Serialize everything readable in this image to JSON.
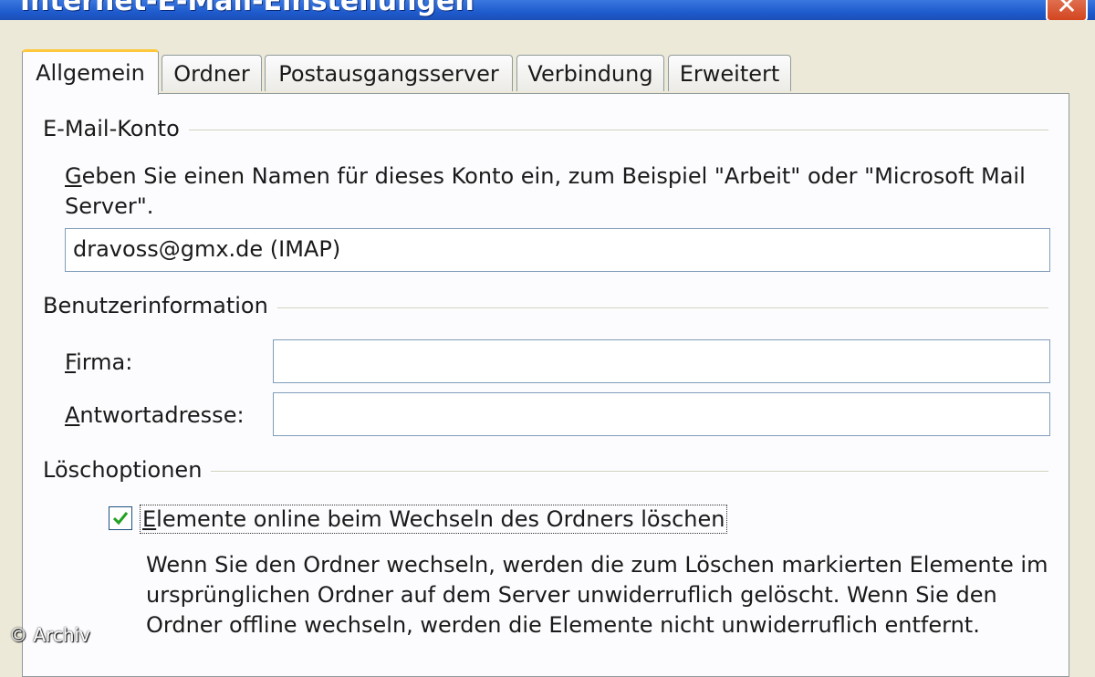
{
  "window": {
    "title": "Internet-E-Mail-Einstellungen",
    "close_icon": "close-icon"
  },
  "tabs": [
    {
      "label": "Allgemein",
      "active": true
    },
    {
      "label": "Ordner",
      "active": false
    },
    {
      "label": "Postausgangsserver",
      "active": false
    },
    {
      "label": "Verbindung",
      "active": false
    },
    {
      "label": "Erweitert",
      "active": false
    }
  ],
  "account": {
    "section_title": "E-Mail-Konto",
    "instruction_underlined": "G",
    "instruction_line1_rest": "eben Sie einen Namen für dieses Konto ein, zum Beispiel \"Arbeit\" oder \"Microsoft Mail",
    "instruction_line2": "Server\".",
    "name_value": "dravoss@gmx.de (IMAP)"
  },
  "user_info": {
    "section_title": "Benutzerinformation",
    "firma_underlined": "F",
    "firma_rest": "irma:",
    "firma_value": "",
    "reply_underlined": "A",
    "reply_rest": "ntwortadresse:",
    "reply_value": ""
  },
  "delete_options": {
    "section_title": "Löschoptionen",
    "checkbox_checked": true,
    "checkbox_underlined": "E",
    "checkbox_label_rest": "lemente online beim Wechseln des Ordners löschen",
    "description_line1": "Wenn Sie den Ordner wechseln, werden die zum Löschen markierten Elemente im",
    "description_line2": "ursprünglichen Ordner auf dem Server unwiderruflich gelöscht. Wenn Sie den",
    "description_line3": "Ordner offline wechseln, werden die Elemente nicht unwiderruflich entfernt."
  },
  "watermark": "© Archiv",
  "colors": {
    "titlebar": "#1f5bcd",
    "active_tab_accent": "#ffc83c",
    "checkmark": "#21a121"
  }
}
